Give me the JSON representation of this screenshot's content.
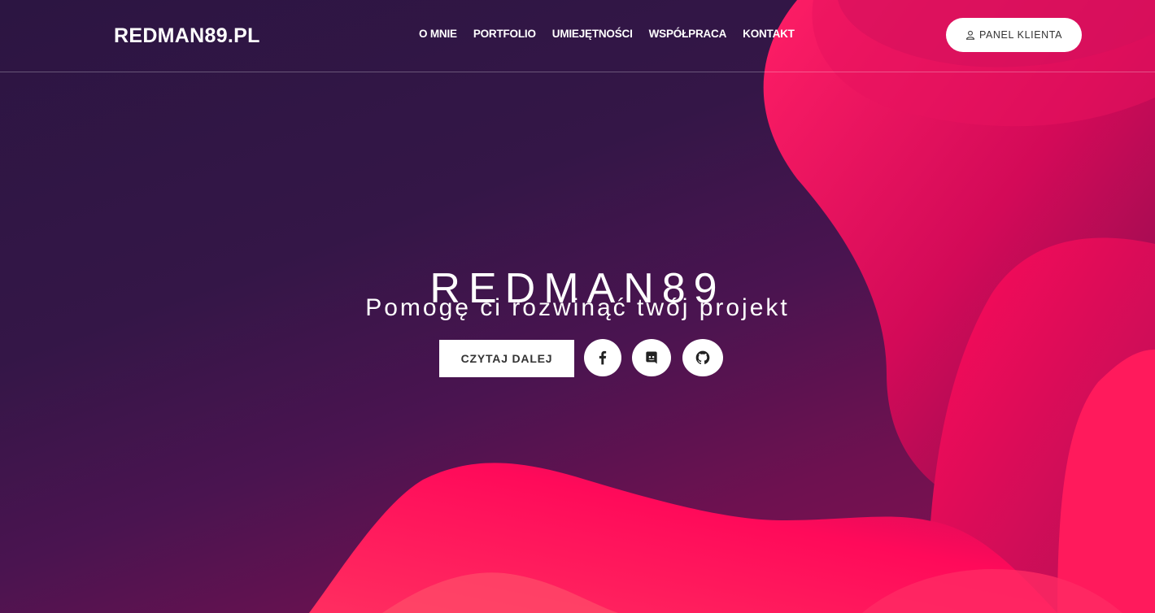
{
  "header": {
    "logo": "REDMAN89.PL",
    "nav": [
      "O MNIE",
      "PORTFOLIO",
      "UMIEJĘTNOŚCI",
      "WSPÓŁPRACA",
      "KONTAKT"
    ],
    "panel_label": "PANEL KLIENTA",
    "panel_icon": "user-icon"
  },
  "hero": {
    "title": "REDMAN89",
    "subtitle": "Pomogę ci rozwinąć twój projekt",
    "cta_label": "CZYTAJ DALEJ",
    "social_icons": [
      "facebook-icon",
      "discord-icon",
      "github-icon"
    ]
  },
  "colors": {
    "background_dark": "#2c1542",
    "accent_pink": "#ff0a5a",
    "accent_magenta": "#c0105a",
    "button_bg": "#ffffff",
    "button_text": "#333333"
  }
}
